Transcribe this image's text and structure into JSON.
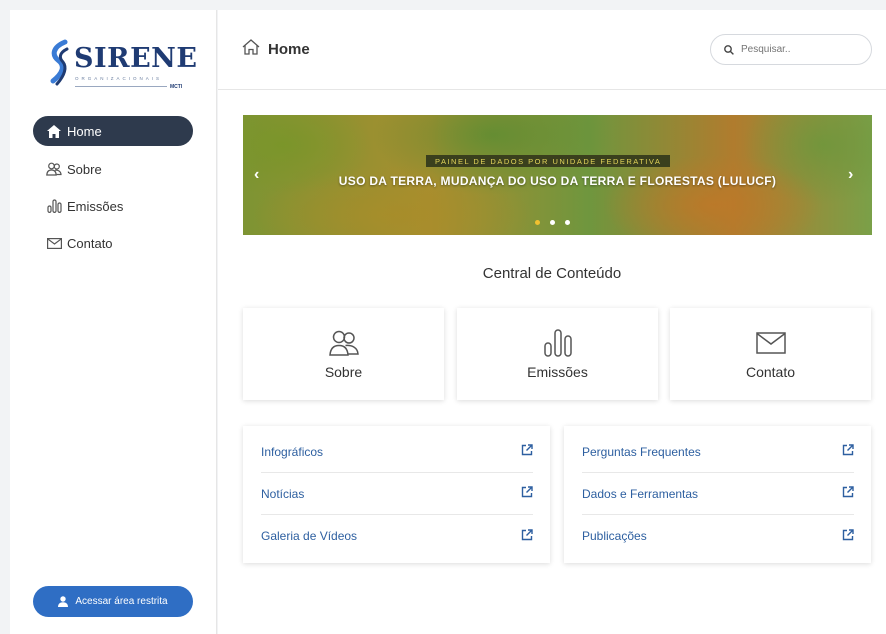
{
  "logo": {
    "name": "SIRENE",
    "subtitle": "ORGANIZACIONAIS",
    "org": "MCTI"
  },
  "sidebar": {
    "items": [
      {
        "label": "Home",
        "icon": "home-icon",
        "active": true
      },
      {
        "label": "Sobre",
        "icon": "users-icon",
        "active": false
      },
      {
        "label": "Emissões",
        "icon": "bar-chart-icon",
        "active": false
      },
      {
        "label": "Contato",
        "icon": "envelope-icon",
        "active": false
      }
    ],
    "restricted_label": "Acessar área restrita"
  },
  "header": {
    "title": "Home",
    "search_placeholder": "Pesquisar.."
  },
  "banner": {
    "tag": "PAINEL DE DADOS POR UNIDADE FEDERATIVA",
    "title": "USO DA TERRA, MUDANÇA DO USO DA TERRA E FLORESTAS (LULUCF)",
    "prev": "‹",
    "next": "›",
    "active_slide": 1,
    "slide_count": 3
  },
  "content": {
    "section_title": "Central de Conteúdo",
    "cards": [
      {
        "label": "Sobre",
        "icon": "users-icon"
      },
      {
        "label": "Emissões",
        "icon": "bar-chart-icon"
      },
      {
        "label": "Contato",
        "icon": "envelope-icon"
      }
    ],
    "links_left": [
      "Infográficos",
      "Notícias",
      "Galeria de Vídeos"
    ],
    "links_right": [
      "Perguntas Frequentes",
      "Dados e Ferramentas",
      "Publicações"
    ]
  },
  "colors": {
    "sidebar_active": "#2e3a4d",
    "accent_blue": "#2f6ec4",
    "link_blue": "#2d5fa0",
    "brand_navy": "#1f3b73"
  }
}
